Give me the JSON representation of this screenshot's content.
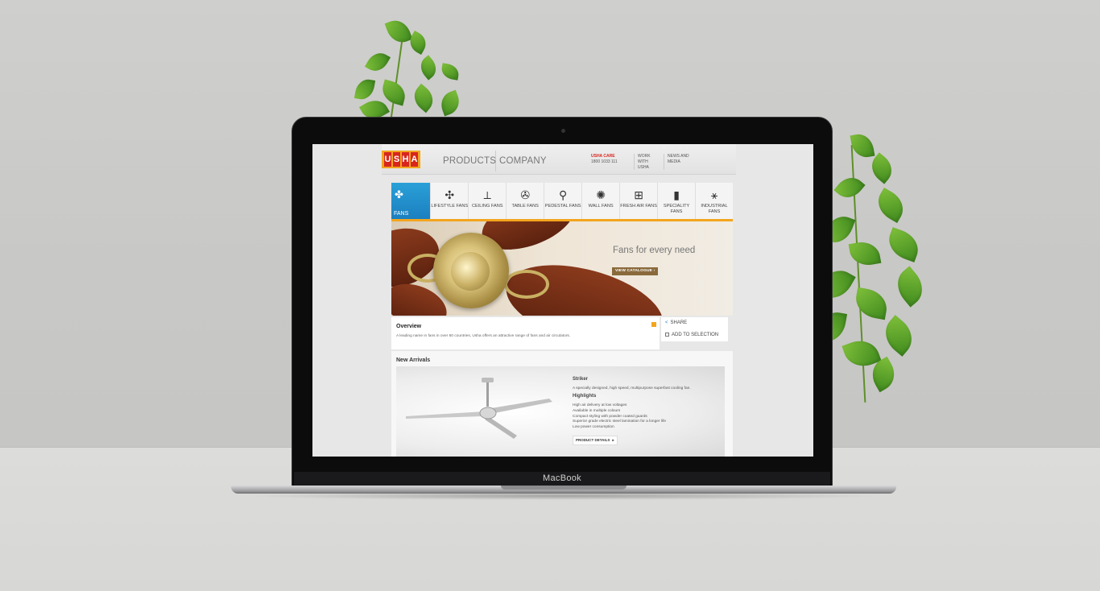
{
  "device": {
    "brand_label": "MacBook"
  },
  "site": {
    "logo_letters": [
      "U",
      "S",
      "H",
      "A"
    ],
    "nav": {
      "products": "PRODUCTS",
      "company": "COMPANY"
    },
    "care": {
      "title": "USHA CARE",
      "number": "1800 1033 111"
    },
    "work_with": [
      "WORK WITH",
      "USHA"
    ],
    "news_media": [
      "NEWS AND",
      "MEDIA"
    ],
    "categories": [
      {
        "label": "FANS",
        "icon": "fans-logo-icon",
        "active": true
      },
      {
        "label": "LIFESTYLE FANS",
        "icon": "lifestyle-fan-icon",
        "active": false
      },
      {
        "label": "CEILING FANS",
        "icon": "ceiling-fan-icon",
        "active": false
      },
      {
        "label": "TABLE FANS",
        "icon": "table-fan-icon",
        "active": false
      },
      {
        "label": "PEDESTAL FANS",
        "icon": "pedestal-fan-icon",
        "active": false
      },
      {
        "label": "WALL FANS",
        "icon": "wall-fan-icon",
        "active": false
      },
      {
        "label": "FRESH AIR FANS",
        "icon": "fresh-air-fan-icon",
        "active": false
      },
      {
        "label": "SPECIALITY FANS",
        "icon": "speciality-fan-icon",
        "active": false
      },
      {
        "label": "INDUSTRIAL FANS",
        "icon": "industrial-fan-icon",
        "active": false
      }
    ],
    "hero": {
      "title": "Fans for every need",
      "button": "VIEW CATALOGUE"
    },
    "overview": {
      "title": "Overview",
      "text": "A leading name in fans in over 60 countries, Usha offers an attractive range of fans and air circulators."
    },
    "actions": {
      "share": "SHARE",
      "add_to_selection": "ADD TO SELECTION"
    },
    "new_arrivals": {
      "title": "New Arrivals",
      "product": {
        "name": "Striker",
        "description": "A specially designed, high speed, multipurpose superfast cooling fan.",
        "highlights_title": "Highlights",
        "highlights": [
          "High air delivery at low voltages",
          "Available in multiple colours",
          "Compact styling with powder coated guards",
          "Superior grade electric steel lamination for a longer life",
          "Low power consumption"
        ],
        "button": "PRODUCT DETAILS"
      }
    }
  },
  "colors": {
    "brand_red": "#d7261e",
    "brand_orange": "#f3a51e",
    "active_blue": "#1b7fbf"
  }
}
